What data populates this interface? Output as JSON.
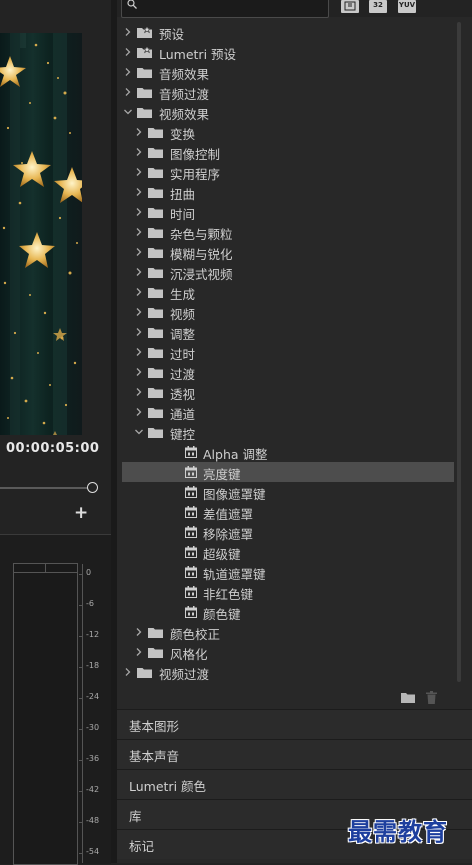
{
  "monitor": {
    "timecode": "00:00:05:00",
    "add_label": "+"
  },
  "meter": {
    "scale": [
      "0",
      "-6",
      "-12",
      "-18",
      "-24",
      "-30",
      "-36",
      "-42",
      "-48",
      "-54"
    ]
  },
  "toolbar": {
    "buttons": [
      "32",
      "YUV"
    ]
  },
  "effects_tree": [
    {
      "label": "预设",
      "depth": 0,
      "state": "collapsed",
      "icon": "preset-folder"
    },
    {
      "label": "Lumetri 预设",
      "depth": 0,
      "state": "collapsed",
      "icon": "preset-folder"
    },
    {
      "label": "音频效果",
      "depth": 0,
      "state": "collapsed",
      "icon": "folder"
    },
    {
      "label": "音频过渡",
      "depth": 0,
      "state": "collapsed",
      "icon": "folder"
    },
    {
      "label": "视频效果",
      "depth": 0,
      "state": "expanded",
      "icon": "folder"
    },
    {
      "label": "变换",
      "depth": 1,
      "state": "collapsed",
      "icon": "folder"
    },
    {
      "label": "图像控制",
      "depth": 1,
      "state": "collapsed",
      "icon": "folder"
    },
    {
      "label": "实用程序",
      "depth": 1,
      "state": "collapsed",
      "icon": "folder"
    },
    {
      "label": "扭曲",
      "depth": 1,
      "state": "collapsed",
      "icon": "folder"
    },
    {
      "label": "时间",
      "depth": 1,
      "state": "collapsed",
      "icon": "folder"
    },
    {
      "label": "杂色与颗粒",
      "depth": 1,
      "state": "collapsed",
      "icon": "folder"
    },
    {
      "label": "模糊与锐化",
      "depth": 1,
      "state": "collapsed",
      "icon": "folder"
    },
    {
      "label": "沉浸式视频",
      "depth": 1,
      "state": "collapsed",
      "icon": "folder"
    },
    {
      "label": "生成",
      "depth": 1,
      "state": "collapsed",
      "icon": "folder"
    },
    {
      "label": "视频",
      "depth": 1,
      "state": "collapsed",
      "icon": "folder"
    },
    {
      "label": "调整",
      "depth": 1,
      "state": "collapsed",
      "icon": "folder"
    },
    {
      "label": "过时",
      "depth": 1,
      "state": "collapsed",
      "icon": "folder"
    },
    {
      "label": "过渡",
      "depth": 1,
      "state": "collapsed",
      "icon": "folder"
    },
    {
      "label": "透视",
      "depth": 1,
      "state": "collapsed",
      "icon": "folder"
    },
    {
      "label": "通道",
      "depth": 1,
      "state": "collapsed",
      "icon": "folder"
    },
    {
      "label": "键控",
      "depth": 1,
      "state": "expanded",
      "icon": "folder"
    },
    {
      "label": "Alpha 调整",
      "depth": 2,
      "state": "leaf",
      "icon": "effect"
    },
    {
      "label": "亮度键",
      "depth": 2,
      "state": "leaf",
      "icon": "effect",
      "selected": true
    },
    {
      "label": "图像遮罩键",
      "depth": 2,
      "state": "leaf",
      "icon": "effect"
    },
    {
      "label": "差值遮罩",
      "depth": 2,
      "state": "leaf",
      "icon": "effect"
    },
    {
      "label": "移除遮罩",
      "depth": 2,
      "state": "leaf",
      "icon": "effect"
    },
    {
      "label": "超级键",
      "depth": 2,
      "state": "leaf",
      "icon": "effect"
    },
    {
      "label": "轨道遮罩键",
      "depth": 2,
      "state": "leaf",
      "icon": "effect"
    },
    {
      "label": "非红色键",
      "depth": 2,
      "state": "leaf",
      "icon": "effect"
    },
    {
      "label": "颜色键",
      "depth": 2,
      "state": "leaf",
      "icon": "effect"
    },
    {
      "label": "颜色校正",
      "depth": 1,
      "state": "collapsed",
      "icon": "folder"
    },
    {
      "label": "风格化",
      "depth": 1,
      "state": "collapsed",
      "icon": "folder"
    },
    {
      "label": "视频过渡",
      "depth": 0,
      "state": "collapsed",
      "icon": "folder"
    }
  ],
  "sections": [
    "基本图形",
    "基本声音",
    "Lumetri 颜色",
    "库",
    "标记"
  ],
  "watermark": "最需教育",
  "colors": {
    "panel_bg": "#282828",
    "selected_row": "#4d4d4d",
    "text": "#cfcfcf",
    "watermark": "#1d3f9e"
  }
}
